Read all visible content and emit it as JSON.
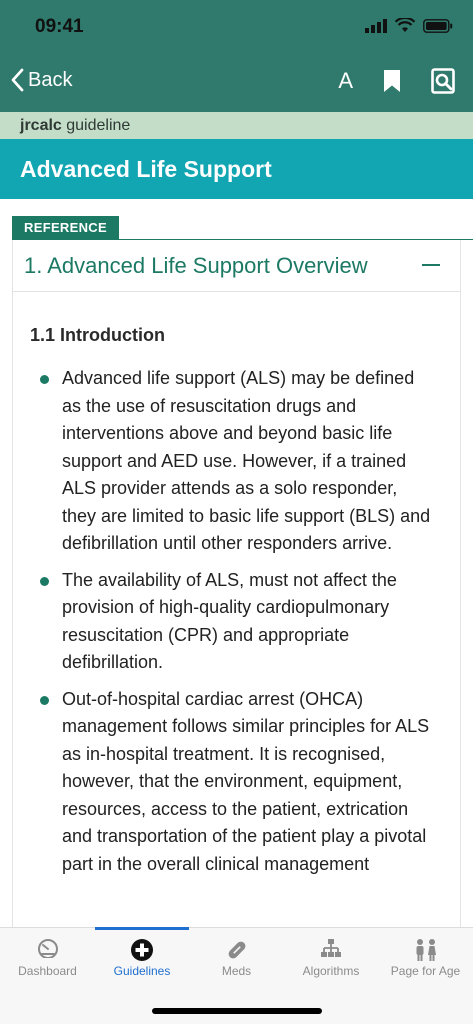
{
  "status": {
    "time": "09:41"
  },
  "nav": {
    "back_label": "Back",
    "font_label": "A"
  },
  "brand": {
    "bold": "jrcalc",
    "rest": " guideline"
  },
  "page": {
    "title": "Advanced Life Support",
    "reference_tab": "REFERENCE"
  },
  "section": {
    "title": "1. Advanced Life Support Overview",
    "sub_heading": "1.1 Introduction",
    "bullets": [
      "Advanced life support (ALS) may be defined as the use of resuscitation drugs and interventions above and beyond basic life support and AED use. However, if a trained ALS provider attends as a solo responder, they are limited to basic life support (BLS) and defibrillation until other responders arrive.",
      "The availability of ALS, must not affect the provision of high-quality cardiopulmonary resuscitation (CPR) and appropriate defibrillation.",
      "Out-of-hospital cardiac arrest (OHCA) management follows similar principles for ALS as in-hospital treatment. It is recognised, however, that the environment, equipment, resources, access to the patient, extrication and transportation of the patient play a pivotal part in the overall clinical management"
    ]
  },
  "tabs": [
    {
      "label": "Dashboard",
      "icon": "dashboard-gauge-icon"
    },
    {
      "label": "Guidelines",
      "icon": "medical-cross-icon",
      "active": true
    },
    {
      "label": "Meds",
      "icon": "pill-icon"
    },
    {
      "label": "Algorithms",
      "icon": "flowchart-icon"
    },
    {
      "label": "Page for Age",
      "icon": "people-icon"
    }
  ],
  "colors": {
    "header": "#2f7a6c",
    "brand_bar": "#c4ddc8",
    "title_bar": "#12a6b3",
    "accent_green": "#1c7a64",
    "active_tab": "#1f6fd0"
  }
}
